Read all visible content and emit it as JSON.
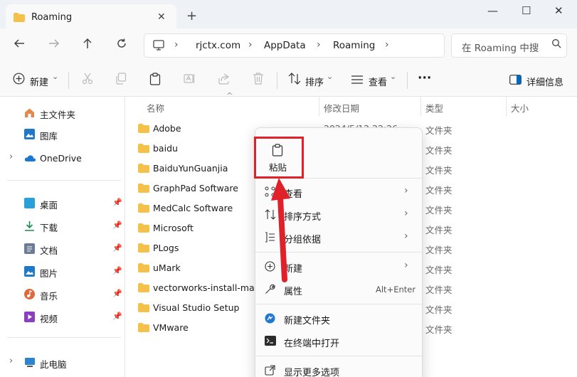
{
  "window": {
    "tab_title": "Roaming",
    "close_tab": "✕",
    "new_tab": "+",
    "minimize": "—",
    "maximize": "☐",
    "close": "✕"
  },
  "address": {
    "crumbs": [
      "rjctx.com",
      "AppData",
      "Roaming"
    ],
    "separator": "›",
    "search_placeholder": "在 Roaming 中搜"
  },
  "toolbar": {
    "new_label": "新建",
    "sort_label": "排序",
    "view_label": "查看",
    "more_label": "···",
    "details_label": "详细信息",
    "dropdown": "⌄"
  },
  "sidebar": {
    "items": [
      {
        "label": "主文件夹",
        "icon": "home-icon"
      },
      {
        "label": "图库",
        "icon": "gallery-icon"
      },
      {
        "label": "OneDrive",
        "icon": "cloud-icon"
      },
      {
        "label": "桌面",
        "icon": "desktop-icon"
      },
      {
        "label": "下载",
        "icon": "download-icon"
      },
      {
        "label": "文档",
        "icon": "document-icon"
      },
      {
        "label": "图片",
        "icon": "pictures-icon"
      },
      {
        "label": "音乐",
        "icon": "music-icon"
      },
      {
        "label": "视频",
        "icon": "video-icon"
      },
      {
        "label": "此电脑",
        "icon": "computer-icon"
      }
    ],
    "expand": "›"
  },
  "columns": {
    "name": "名称",
    "date": "修改日期",
    "type": "类型",
    "size": "大小"
  },
  "files": [
    {
      "name": "Adobe",
      "date": "2024/5/12 22:26",
      "type": "文件夹"
    },
    {
      "name": "baidu",
      "date": "",
      "type": "文件夹"
    },
    {
      "name": "BaiduYunGuanjia",
      "date": "",
      "type": "文件夹"
    },
    {
      "name": "GraphPad Software",
      "date": "",
      "type": "文件夹"
    },
    {
      "name": "MedCalc Software",
      "date": "",
      "type": "文件夹"
    },
    {
      "name": "Microsoft",
      "date": "",
      "type": "文件夹"
    },
    {
      "name": "PLogs",
      "date": "",
      "type": "文件夹"
    },
    {
      "name": "uMark",
      "date": "",
      "type": "文件夹"
    },
    {
      "name": "vectorworks-install-manager",
      "date": "",
      "type": "文件夹"
    },
    {
      "name": "Visual Studio Setup",
      "date": "",
      "type": "文件夹"
    },
    {
      "name": "VMware",
      "date": "",
      "type": "文件夹"
    }
  ],
  "context_menu": {
    "paste": "粘贴",
    "view": "查看",
    "sort_by": "排序方式",
    "group_by": "分组依据",
    "new": "新建",
    "properties": "属性",
    "properties_shortcut": "Alt+Enter",
    "new_folder": "新建文件夹",
    "open_terminal": "在终端中打开",
    "more_options": "显示更多选项",
    "chevron": "›"
  },
  "colors": {
    "folder": "#f4c14a",
    "annotation_red": "#e0212a",
    "accent": "#0067c0"
  }
}
